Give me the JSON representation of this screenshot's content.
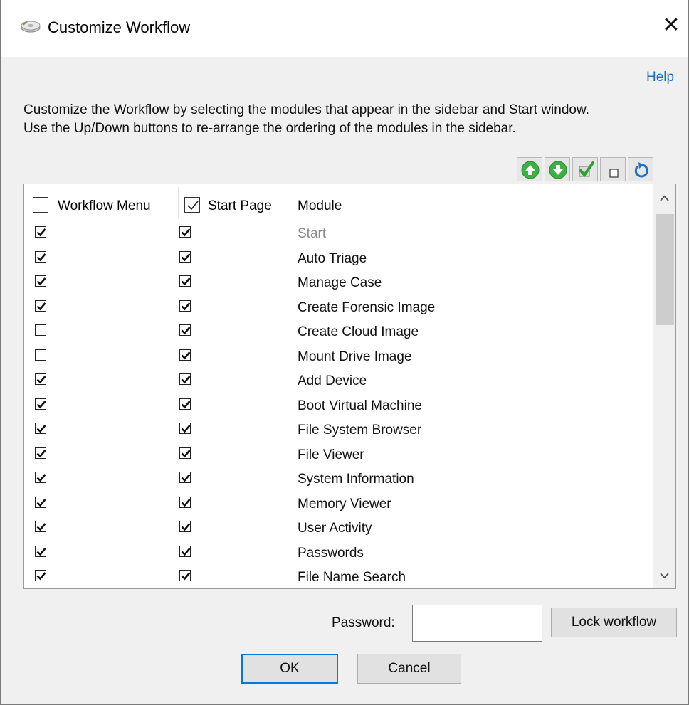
{
  "window": {
    "title": "Customize Workflow",
    "close_glyph": "✕",
    "icon": "app-disk-icon"
  },
  "help_label": "Help",
  "description": {
    "line1": "Customize the Workflow by selecting the modules that appear in the sidebar and Start window.",
    "line2": "Use the Up/Down buttons to re-arrange the ordering of the modules in the sidebar."
  },
  "toolbar": [
    {
      "name": "move-up-button",
      "icon": "arrow-up-circle-icon",
      "color": "#3cb043"
    },
    {
      "name": "move-down-button",
      "icon": "arrow-down-circle-icon",
      "color": "#3cb043"
    },
    {
      "name": "check-all-button",
      "icon": "check-icon",
      "color": "#2ea02e"
    },
    {
      "name": "uncheck-all-button",
      "icon": "empty-box-icon",
      "color": "#444444"
    },
    {
      "name": "reset-button",
      "icon": "reset-icon",
      "color": "#1a6fc4"
    }
  ],
  "table": {
    "columns": [
      {
        "label": "Workflow Menu",
        "checked": false
      },
      {
        "label": "Start Page",
        "checked": true
      },
      {
        "label": "Module"
      }
    ],
    "rows": [
      {
        "workflow": true,
        "start": true,
        "module": "Start",
        "disabled": true
      },
      {
        "workflow": true,
        "start": true,
        "module": "Auto Triage",
        "disabled": false
      },
      {
        "workflow": true,
        "start": true,
        "module": "Manage Case",
        "disabled": false
      },
      {
        "workflow": true,
        "start": true,
        "module": "Create Forensic Image",
        "disabled": false
      },
      {
        "workflow": false,
        "start": true,
        "module": "Create Cloud Image",
        "disabled": false
      },
      {
        "workflow": false,
        "start": true,
        "module": "Mount Drive Image",
        "disabled": false
      },
      {
        "workflow": true,
        "start": true,
        "module": "Add Device",
        "disabled": false
      },
      {
        "workflow": true,
        "start": true,
        "module": "Boot Virtual Machine",
        "disabled": false
      },
      {
        "workflow": true,
        "start": true,
        "module": "File System Browser",
        "disabled": false
      },
      {
        "workflow": true,
        "start": true,
        "module": "File Viewer",
        "disabled": false
      },
      {
        "workflow": true,
        "start": true,
        "module": "System Information",
        "disabled": false
      },
      {
        "workflow": true,
        "start": true,
        "module": "Memory Viewer",
        "disabled": false
      },
      {
        "workflow": true,
        "start": true,
        "module": "User Activity",
        "disabled": false
      },
      {
        "workflow": true,
        "start": true,
        "module": "Passwords",
        "disabled": false
      },
      {
        "workflow": true,
        "start": true,
        "module": "File Name Search",
        "disabled": false
      }
    ]
  },
  "password": {
    "label": "Password:",
    "value": ""
  },
  "lock_button_label": "Lock workflow",
  "ok_label": "OK",
  "cancel_label": "Cancel"
}
